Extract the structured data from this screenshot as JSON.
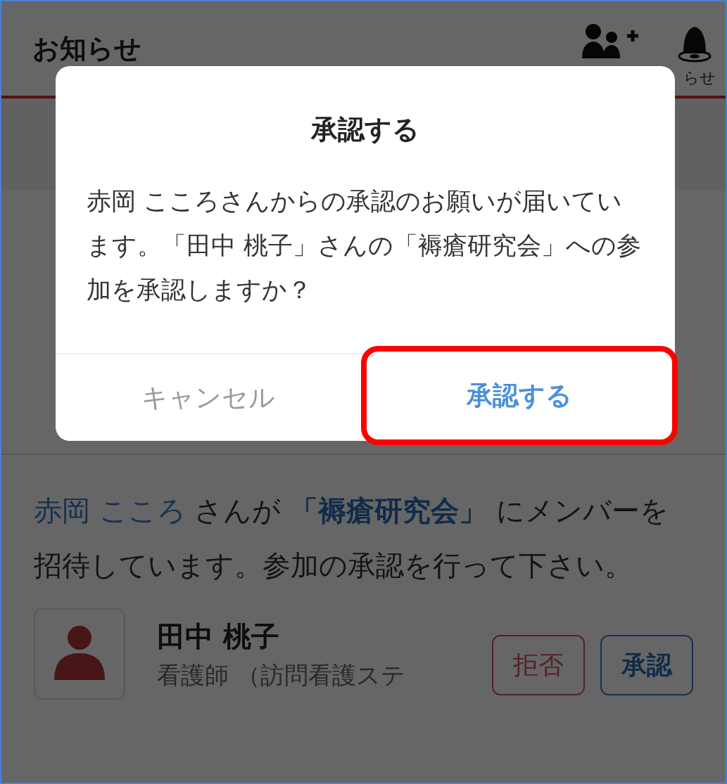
{
  "header": {
    "title": "お知らせ",
    "icons": [
      {
        "kind": "add-user"
      },
      {
        "kind": "bell",
        "label": "らせ"
      }
    ]
  },
  "notification": {
    "message": [
      {
        "kind": "link",
        "text": "赤岡 こころ"
      },
      {
        "kind": "plain",
        "text": " さんが "
      },
      {
        "kind": "strong-link",
        "text": "「褥瘡研究会」"
      },
      {
        "kind": "plain",
        "text": " にメンバーを招待しています。参加の承認を行って下さい。"
      }
    ],
    "member": {
      "name": "田中 桃子",
      "subtitle": "看護師 （訪問看護ステ"
    },
    "actions": [
      {
        "kind": "reject",
        "label": "拒否"
      },
      {
        "kind": "approve",
        "label": "承認"
      }
    ]
  },
  "dialog": {
    "title": "承認する",
    "body": "赤岡 こころさんからの承認のお願いが届いています。「田中 桃子」さんの「褥瘡研究会」への参加を承認しますか？",
    "buttons": [
      {
        "kind": "cancel",
        "label": "キャンセル",
        "highlighted": false
      },
      {
        "kind": "confirm",
        "label": "承認する",
        "highlighted": true
      }
    ]
  }
}
